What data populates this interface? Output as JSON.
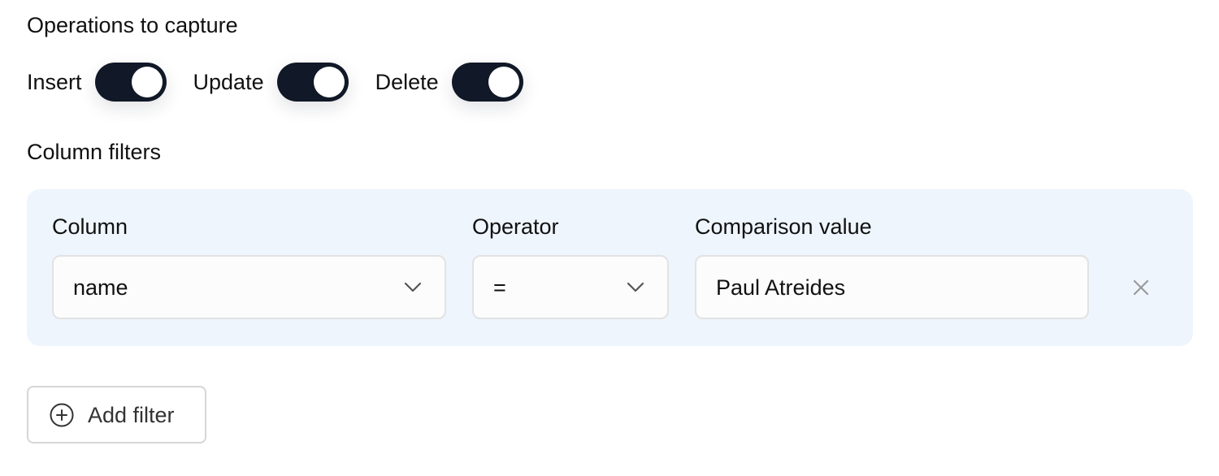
{
  "operations": {
    "title": "Operations to capture",
    "items": [
      {
        "label": "Insert",
        "enabled": true
      },
      {
        "label": "Update",
        "enabled": true
      },
      {
        "label": "Delete",
        "enabled": true
      }
    ]
  },
  "column_filters": {
    "title": "Column filters",
    "labels": {
      "column": "Column",
      "operator": "Operator",
      "comparison": "Comparison value"
    },
    "filter": {
      "column": "name",
      "operator": "=",
      "comparison_value": "Paul Atreides"
    },
    "add_filter_label": "Add filter"
  },
  "icons": {
    "column_select": "chevron-down-icon",
    "operator_select": "chevron-down-icon",
    "remove_filter": "close-icon",
    "add_filter": "plus-circle-icon"
  },
  "colors": {
    "toggle_on": "#111827",
    "filter_panel_bg": "#eef5fd"
  }
}
